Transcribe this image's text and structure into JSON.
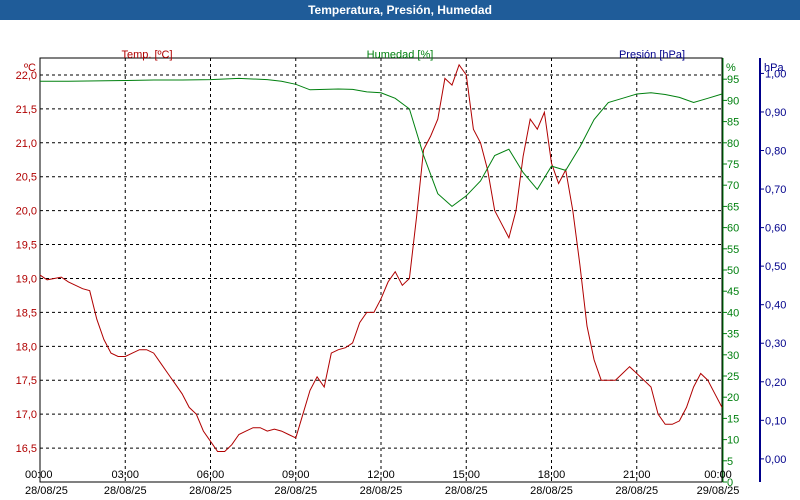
{
  "window_title": "Temperatura, Presión, Humedad",
  "colors": {
    "temp": "#b00000",
    "hum": "#00800f",
    "pres": "#00008b",
    "title_bg": "#1f5c99",
    "grid": "#000000"
  },
  "chart_data": {
    "type": "line",
    "title": "Temperatura, Presión, Humedad",
    "grid": true,
    "axes": {
      "temp": {
        "label": "Temp. [ºC]",
        "unit": "ºC",
        "min": 16.0,
        "max": 22.25,
        "ticks": [
          16.5,
          17.0,
          17.5,
          18.0,
          18.5,
          19.0,
          19.5,
          20.0,
          20.5,
          21.0,
          21.5,
          22.0
        ]
      },
      "hum": {
        "label": "Humedad [%]",
        "unit": "%",
        "min": 0,
        "max": 100,
        "ticks": [
          0,
          5,
          10,
          15,
          20,
          25,
          30,
          35,
          40,
          45,
          50,
          55,
          60,
          65,
          70,
          75,
          80,
          85,
          90,
          95
        ]
      },
      "pres": {
        "label": "Presión [hPa]",
        "unit": "hPa",
        "min": -0.06,
        "max": 1.04,
        "ticks": [
          0.0,
          0.1,
          0.2,
          0.3,
          0.4,
          0.5,
          0.6,
          0.7,
          0.8,
          0.9,
          1.0
        ],
        "tick_labels": [
          "0,00",
          "0,10",
          "0,20",
          "0,30",
          "0,40",
          "0,50",
          "0,60",
          "0,70",
          "0,80",
          "0,90",
          "1,00"
        ]
      },
      "x": {
        "ticks": [
          {
            "time": "00:00",
            "date": "28/08/25",
            "h": 0
          },
          {
            "time": "03:00",
            "date": "28/08/25",
            "h": 3
          },
          {
            "time": "06:00",
            "date": "28/08/25",
            "h": 6
          },
          {
            "time": "09:00",
            "date": "28/08/25",
            "h": 9
          },
          {
            "time": "12:00",
            "date": "28/08/25",
            "h": 12
          },
          {
            "time": "15:00",
            "date": "28/08/25",
            "h": 15
          },
          {
            "time": "18:00",
            "date": "28/08/25",
            "h": 18
          },
          {
            "time": "21:00",
            "date": "28/08/25",
            "h": 21
          },
          {
            "time": "00:00",
            "date": "29/08/25",
            "h": 24
          }
        ]
      }
    },
    "series": [
      {
        "name": "Temp. [ºC]",
        "axis": "temp",
        "x": [
          0,
          0.25,
          0.5,
          0.75,
          1.0,
          1.25,
          1.5,
          1.75,
          2.0,
          2.25,
          2.5,
          2.75,
          3.0,
          3.25,
          3.5,
          3.75,
          4.0,
          4.25,
          4.5,
          4.75,
          5.0,
          5.25,
          5.5,
          5.75,
          6.0,
          6.25,
          6.5,
          6.75,
          7.0,
          7.25,
          7.5,
          7.75,
          8.0,
          8.25,
          8.5,
          8.75,
          9.0,
          9.25,
          9.5,
          9.75,
          10.0,
          10.25,
          10.5,
          10.75,
          11.0,
          11.25,
          11.5,
          11.75,
          12.0,
          12.25,
          12.5,
          12.75,
          13.0,
          13.25,
          13.5,
          13.75,
          14.0,
          14.25,
          14.5,
          14.75,
          15.0,
          15.25,
          15.5,
          15.75,
          16.0,
          16.25,
          16.5,
          16.75,
          17.0,
          17.25,
          17.5,
          17.75,
          18.0,
          18.25,
          18.5,
          18.75,
          19.0,
          19.25,
          19.5,
          19.75,
          20.0,
          20.25,
          20.5,
          20.75,
          21.0,
          21.25,
          21.5,
          21.75,
          22.0,
          22.25,
          22.5,
          22.75,
          23.0,
          23.25,
          23.5,
          23.75,
          24.0
        ],
        "values": [
          19.05,
          18.98,
          19.0,
          19.02,
          18.95,
          18.9,
          18.85,
          18.82,
          18.4,
          18.1,
          17.9,
          17.85,
          17.85,
          17.9,
          17.95,
          17.95,
          17.9,
          17.75,
          17.6,
          17.45,
          17.3,
          17.1,
          17.0,
          16.75,
          16.6,
          16.45,
          16.45,
          16.55,
          16.7,
          16.75,
          16.8,
          16.8,
          16.75,
          16.78,
          16.75,
          16.7,
          16.65,
          17.0,
          17.35,
          17.55,
          17.4,
          17.9,
          17.95,
          17.98,
          18.05,
          18.35,
          18.5,
          18.5,
          18.7,
          18.95,
          19.1,
          18.9,
          19.0,
          19.9,
          20.9,
          21.1,
          21.35,
          21.95,
          21.85,
          22.15,
          22.0,
          21.2,
          21.0,
          20.6,
          20.0,
          19.8,
          19.6,
          20.0,
          20.8,
          21.35,
          21.2,
          21.45,
          20.7,
          20.4,
          20.6,
          20.0,
          19.2,
          18.3,
          17.8,
          17.5,
          17.5,
          17.5,
          17.6,
          17.7,
          17.6,
          17.5,
          17.4,
          17.0,
          16.85,
          16.85,
          16.9,
          17.1,
          17.4,
          17.6,
          17.5,
          17.3,
          17.1
        ]
      },
      {
        "name": "Humedad [%]",
        "axis": "hum",
        "x": [
          0,
          1,
          2,
          3,
          4,
          5,
          6,
          7,
          8,
          8.5,
          9,
          9.5,
          10,
          10.5,
          11,
          11.5,
          12,
          12.5,
          13,
          13.5,
          14,
          14.5,
          15,
          15.5,
          16,
          16.5,
          17,
          17.5,
          18,
          18.5,
          19,
          19.5,
          20,
          20.5,
          21,
          21.5,
          22,
          22.5,
          23,
          23.5,
          24
        ],
        "values": [
          94.5,
          94.5,
          94.6,
          94.7,
          94.8,
          94.8,
          94.9,
          95.2,
          94.9,
          94.5,
          93.8,
          92.5,
          92.6,
          92.7,
          92.6,
          92.0,
          91.8,
          90.5,
          88.0,
          77.0,
          68.0,
          65.0,
          67.5,
          71.0,
          77.0,
          78.5,
          73.0,
          69.0,
          74.5,
          73.5,
          79.0,
          85.5,
          89.5,
          90.5,
          91.5,
          91.8,
          91.4,
          90.7,
          89.5,
          90.5,
          91.5
        ]
      },
      {
        "name": "Presión [hPa]",
        "axis": "pres",
        "x": [],
        "values": []
      }
    ]
  }
}
